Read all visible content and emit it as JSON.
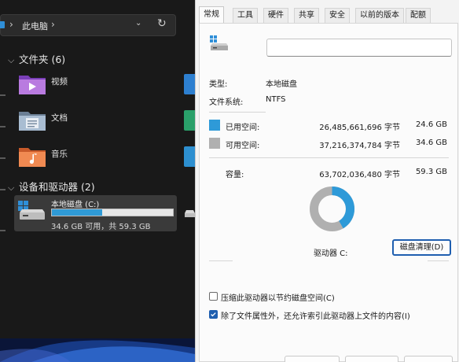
{
  "explorer": {
    "breadcrumb": "此电脑",
    "folders_group": {
      "title": "文件夹 (6)"
    },
    "folders": [
      {
        "label": "视频",
        "icon": "video-folder-icon"
      },
      {
        "label": "文档",
        "icon": "documents-folder-icon"
      },
      {
        "label": "音乐",
        "icon": "music-folder-icon"
      }
    ],
    "drives_group": {
      "title": "设备和驱动器 (2)"
    },
    "drive": {
      "name": "本地磁盘 (C:)",
      "free_text": "34.6 GB 可用，共 59.3 GB",
      "used_fraction": 0.416
    }
  },
  "dialog": {
    "tabs": [
      "常规",
      "工具",
      "硬件",
      "共享",
      "安全",
      "以前的版本",
      "配额"
    ],
    "active_tab": "常规",
    "name_value": "",
    "type_label": "类型:",
    "type_value": "本地磁盘",
    "fs_label": "文件系统:",
    "fs_value": "NTFS",
    "used": {
      "label": "已用空间:",
      "bytes": "26,485,661,696 字节",
      "size": "24.6 GB",
      "color": "#2e9ad8"
    },
    "free": {
      "label": "可用空间:",
      "bytes": "37,216,374,784 字节",
      "size": "34.6 GB",
      "color": "#b0b0b0"
    },
    "capacity": {
      "label": "容量:",
      "bytes": "63,702,036,480 字节",
      "size": "59.3 GB"
    },
    "drive_label": "驱动器 C:",
    "cleanup_button": "磁盘清理(D)",
    "compress_label": "压缩此驱动器以节约磁盘空间(C)",
    "compress_checked": false,
    "index_label": "除了文件属性外，还允许索引此驱动器上文件的内容(I)",
    "index_checked": true,
    "used_fraction": 0.416
  }
}
